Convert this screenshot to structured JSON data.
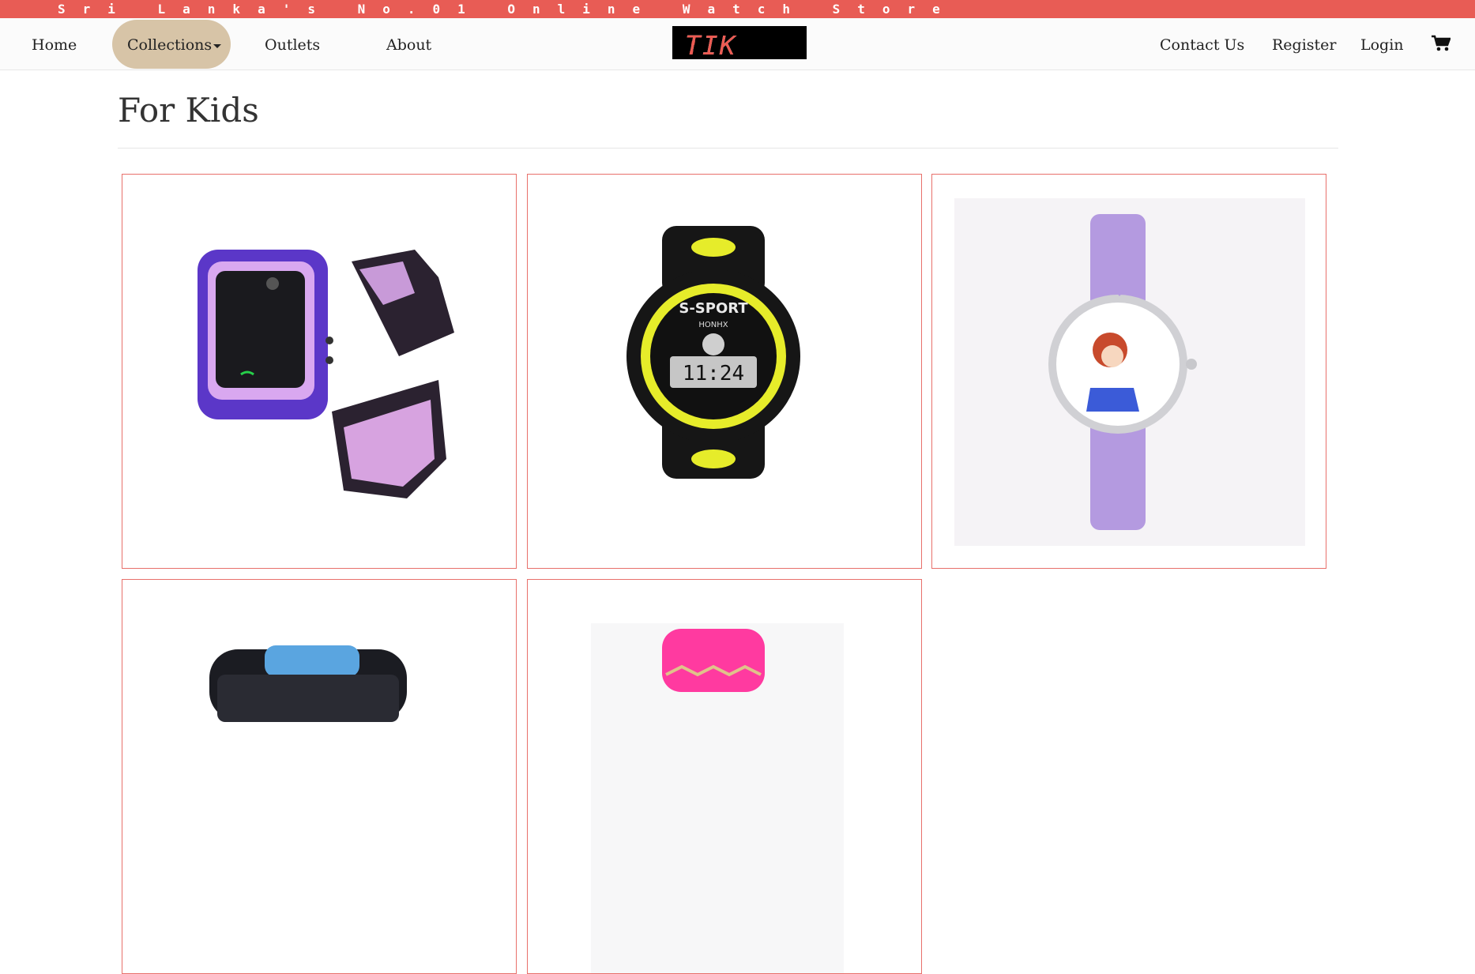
{
  "topbar": {
    "text": "Sri Lanka's No.01 Online Watch Store"
  },
  "nav": {
    "home": "Home",
    "collections": "Collections",
    "outlets": "Outlets",
    "about": "About",
    "contact": "Contact Us",
    "register": "Register",
    "login": "Login",
    "cart_icon": "shopping-cart-icon"
  },
  "logo": {
    "part1": "TIK",
    "sep": ":",
    "part2": "TIK"
  },
  "page": {
    "title": "For Kids"
  },
  "products": [
    {
      "name": "purple-smartwatch",
      "color": "#7b4fd6"
    },
    {
      "name": "black-yellow-sport-watch",
      "color": "#e6ec2a"
    },
    {
      "name": "lilac-princess-watch",
      "color": "#b49ae0"
    },
    {
      "name": "blue-black-smartwatch",
      "color": "#5aa5e0"
    },
    {
      "name": "pink-watch",
      "color": "#ff3aa0"
    }
  ],
  "colors": {
    "topbar": "#e85c55",
    "accent_pill": "#d7c4a7",
    "card_border": "#e8706b"
  }
}
